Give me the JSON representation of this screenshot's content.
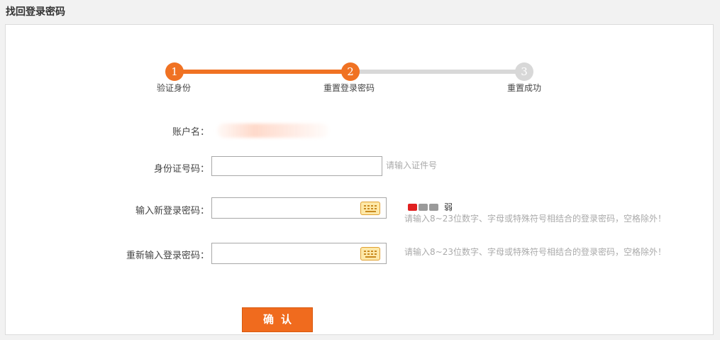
{
  "page": {
    "title": "找回登录密码"
  },
  "steps": [
    {
      "num": "1",
      "label": "验证身份",
      "state": "done"
    },
    {
      "num": "2",
      "label": "重置登录密码",
      "state": "current"
    },
    {
      "num": "3",
      "label": "重置成功",
      "state": "todo"
    }
  ],
  "form": {
    "account_label": "账户名：",
    "id_label": "身份证号码：",
    "id_value": "",
    "id_hint": "请输入证件号",
    "new_pwd_label": "输入新登录密码：",
    "new_pwd_value": "",
    "new_pwd_hint": "请输入8~23位数字、字母或特殊符号相结合的登录密码，空格除外！",
    "strength_text": "弱",
    "strength_level": "1/3",
    "confirm_pwd_label": "重新输入登录密码：",
    "confirm_pwd_value": "",
    "confirm_pwd_hint": "请输入8~23位数字、字母或特殊符号相结合的登录密码，空格除外！",
    "submit_label": "确认"
  },
  "colors": {
    "accent": "#f07223",
    "inactive": "#d8d8d8",
    "weak": "#e02020"
  },
  "icons": {
    "keyboard": "keyboard-icon"
  }
}
